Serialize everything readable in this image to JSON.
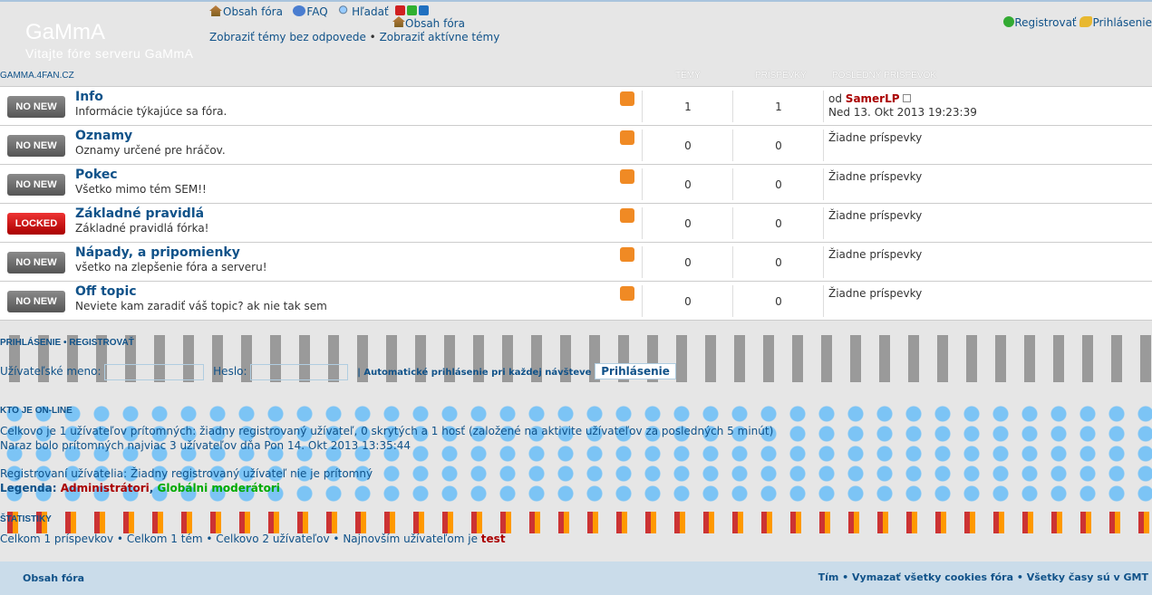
{
  "header": {
    "site_name": "GaMmA",
    "site_desc": "Vitajte fóre serveru GaMmA",
    "nav": {
      "index": "Obsah fóra",
      "faq": "FAQ",
      "search": "Hľadať",
      "index2": "Obsah fóra",
      "unanswered": "Zobraziť témy bez odpovede",
      "active": "Zobraziť aktívne témy",
      "sep": "•"
    },
    "register": "Registrovať",
    "login": "Prihlásenie",
    "style_colors": [
      "#d02020",
      "#30b030",
      "#2070c0"
    ]
  },
  "breadcrumb": "GAMMA.4FAN.CZ",
  "columns": {
    "topics": "TÉMY",
    "posts": "PRÍSPEVKY",
    "last_post": "POSLEDNÝ PRÍSPEVOK"
  },
  "forums": [
    {
      "badge": "NO NEW",
      "title": "Info",
      "desc": "Informácie týkajúce sa fóra.",
      "topics": "1",
      "posts": "1",
      "last_by": "od",
      "last_user": "SamerLP",
      "last_date": "Ned 13. Okt 2013 19:23:39"
    },
    {
      "badge": "NO NEW",
      "title": "Oznamy",
      "desc": "Oznamy určené pre hráčov.",
      "topics": "0",
      "posts": "0",
      "last_none": "Žiadne príspevky"
    },
    {
      "badge": "NO NEW",
      "title": "Pokec",
      "desc": "Všetko mimo tém SEM!!",
      "topics": "0",
      "posts": "0",
      "last_none": "Žiadne príspevky"
    },
    {
      "badge": "LOCKED",
      "title": "Základné pravidlá",
      "desc": "Základné pravidlá fórka!",
      "topics": "0",
      "posts": "0",
      "last_none": "Žiadne príspevky"
    },
    {
      "badge": "NO NEW",
      "title": "Nápady, a pripomienky",
      "desc": "všetko na zlepšenie fóra a serveru!",
      "topics": "0",
      "posts": "0",
      "last_none": "Žiadne príspevky"
    },
    {
      "badge": "NO NEW",
      "title": "Off topic",
      "desc": "Neviete kam zaradiť váš topic? ak nie tak sem",
      "topics": "0",
      "posts": "0",
      "last_none": "Žiadne príspevky"
    }
  ],
  "login": {
    "heading_login": "PRIHLÁSENIE",
    "heading_sep": "•",
    "heading_register": "REGISTROVAŤ",
    "username_label": "Užívateľské meno:",
    "password_label": "Heslo:",
    "auto_login": "Automatické prihlásenie pri každej návšteve",
    "submit": "Prihlásenie"
  },
  "online": {
    "heading": "KTO JE ON-LINE",
    "line1": "Celkovo je 1 užívateľov prítomných: žiadny registrovaný užívateľ, 0 skrytých a 1 hosť (založené na aktivite užívateľov za posledných 5 minút)",
    "line2": "Naraz bolo prítomných najviac 3 užívateľov dňa Pon 14. Okt 2013 13:35:44",
    "registered": "Registrovaní užívatelia: Žiadny registrovaný užívateľ nie je prítomný",
    "legend_label": "Legenda:",
    "legend_admin": "Administrátori",
    "legend_mod": "Globálni moderátori"
  },
  "stats": {
    "heading": "ŠTATISTIKY",
    "text": "Celkom 1 príspevkov • Celkom 1 tém • Celkovo 2 užívateľov • Najnovším užívateľom je",
    "newest": "test"
  },
  "footer": {
    "index": "Obsah fóra",
    "team": "Tím",
    "cookies": "Vymazať všetky cookies fóra",
    "timezone": "Všetky časy sú v GMT"
  }
}
